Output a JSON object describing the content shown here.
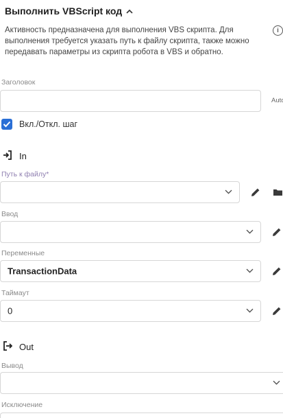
{
  "header": {
    "title": "Выполнить VBScript код",
    "description": "Активность предназначена для выполнения VBS скрипта. Для выполнения требуется указать путь к файлу скрипта, также можно передавать параметры из скрипта робота в VBS  и обратно."
  },
  "fields": {
    "title_label": "Заголовок",
    "title_value": "",
    "auto_label": "Auto",
    "toggle_label": "Вкл./Откл. шаг",
    "toggle_checked": true
  },
  "in_section": {
    "label": "In",
    "path_label": "Путь к файлу*",
    "path_value": "",
    "input_label": "Ввод",
    "input_value": "",
    "variables_label": "Переменные",
    "variables_value": "TransactionData",
    "timeout_label": "Таймаут",
    "timeout_value": "0"
  },
  "out_section": {
    "label": "Out",
    "output_label": "Вывод",
    "output_value": "",
    "exception_label": "Исключение"
  },
  "colors": {
    "accent": "#2a6fd6",
    "border": "#d6d6d6",
    "required_label": "#8f7fb0"
  },
  "icons": [
    "chevron-up-icon",
    "info-icon",
    "checkbox-icon",
    "login-icon",
    "logout-icon",
    "chevron-down-icon",
    "pencil-icon",
    "folder-icon"
  ]
}
